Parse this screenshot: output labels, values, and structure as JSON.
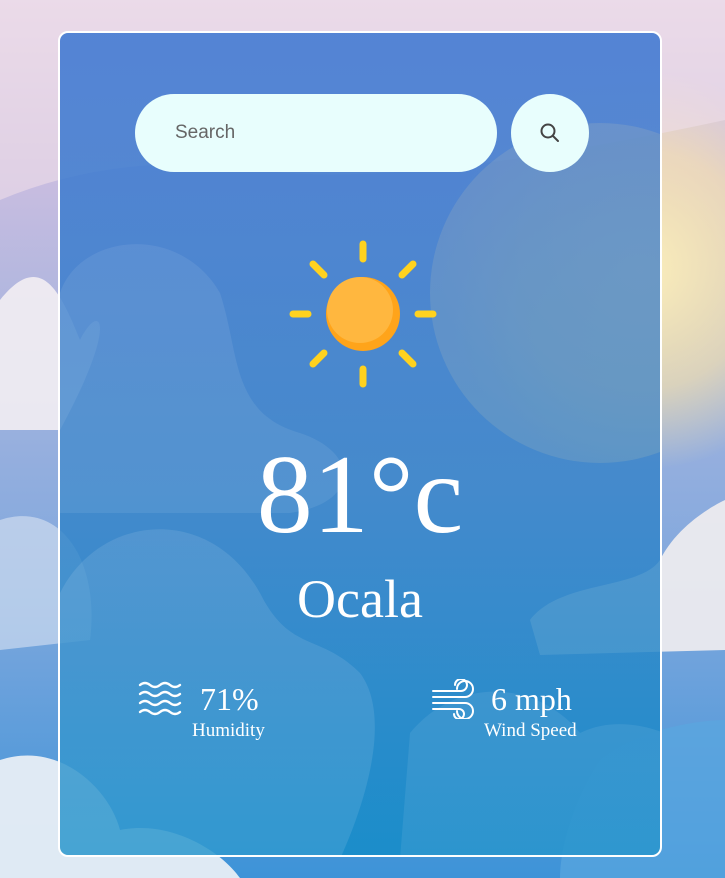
{
  "search": {
    "placeholder": "Search",
    "value": ""
  },
  "icons": {
    "search": "search-icon",
    "weather": "sun-icon",
    "humidity": "waves-icon",
    "wind": "wind-icon"
  },
  "weather": {
    "temperature": "81°c",
    "city": "Ocala",
    "humidity_value": "71%",
    "humidity_label": "Humidity",
    "wind_value": "6 mph",
    "wind_label": "Wind Speed"
  },
  "colors": {
    "sun_rays": "#ffd21f",
    "sun_core": "#ffb53a",
    "input_bg": "#e8fefd",
    "text": "#ffffff"
  }
}
